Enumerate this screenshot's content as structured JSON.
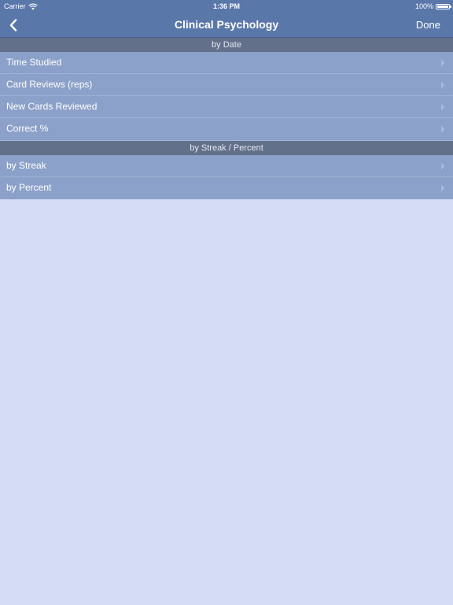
{
  "status_bar": {
    "carrier": "Carrier",
    "time": "1:36 PM",
    "battery": "100%"
  },
  "nav": {
    "title": "Clinical Psychology",
    "done_label": "Done"
  },
  "sections": [
    {
      "header": "by Date",
      "rows": [
        {
          "label": "Time Studied"
        },
        {
          "label": "Card Reviews (reps)"
        },
        {
          "label": "New Cards Reviewed"
        },
        {
          "label": "Correct %"
        }
      ]
    },
    {
      "header": "by Streak / Percent",
      "rows": [
        {
          "label": "by Streak"
        },
        {
          "label": "by Percent"
        }
      ]
    }
  ],
  "colors": {
    "nav_bar": "#5a77aa",
    "section_header": "#637089",
    "row": "#8ca1c9",
    "background": "#d5dcf5"
  }
}
